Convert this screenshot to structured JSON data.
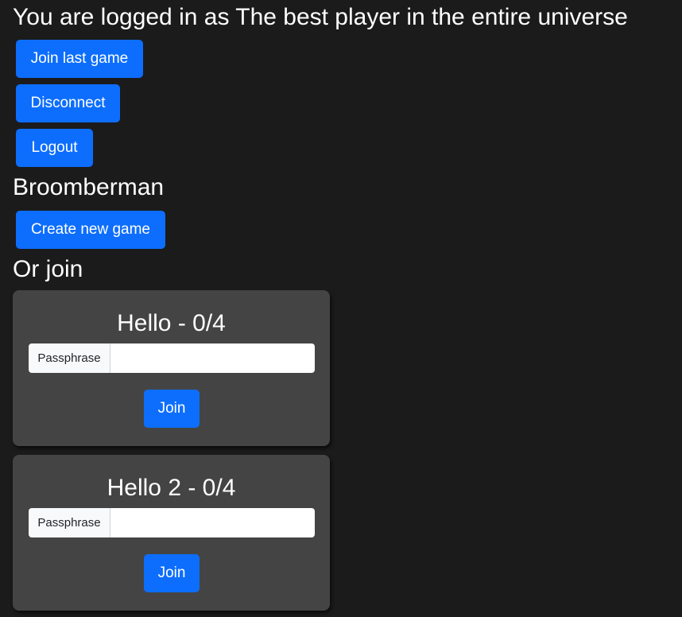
{
  "header": {
    "logged_in_text": "You are logged in as The best player in the entire universe"
  },
  "actions": {
    "join_last_label": "Join last game",
    "disconnect_label": "Disconnect",
    "logout_label": "Logout"
  },
  "game": {
    "title": "Broomberman",
    "create_label": "Create new game",
    "or_join_label": "Or join"
  },
  "lobbies": [
    {
      "title": "Hello - 0/4",
      "passphrase_label": "Passphrase",
      "passphrase_value": "",
      "join_label": "Join"
    },
    {
      "title": "Hello 2 - 0/4",
      "passphrase_label": "Passphrase",
      "passphrase_value": "",
      "join_label": "Join"
    }
  ],
  "colors": {
    "background": "#1b1b1b",
    "card": "#444444",
    "primary": "#0d6efd"
  }
}
